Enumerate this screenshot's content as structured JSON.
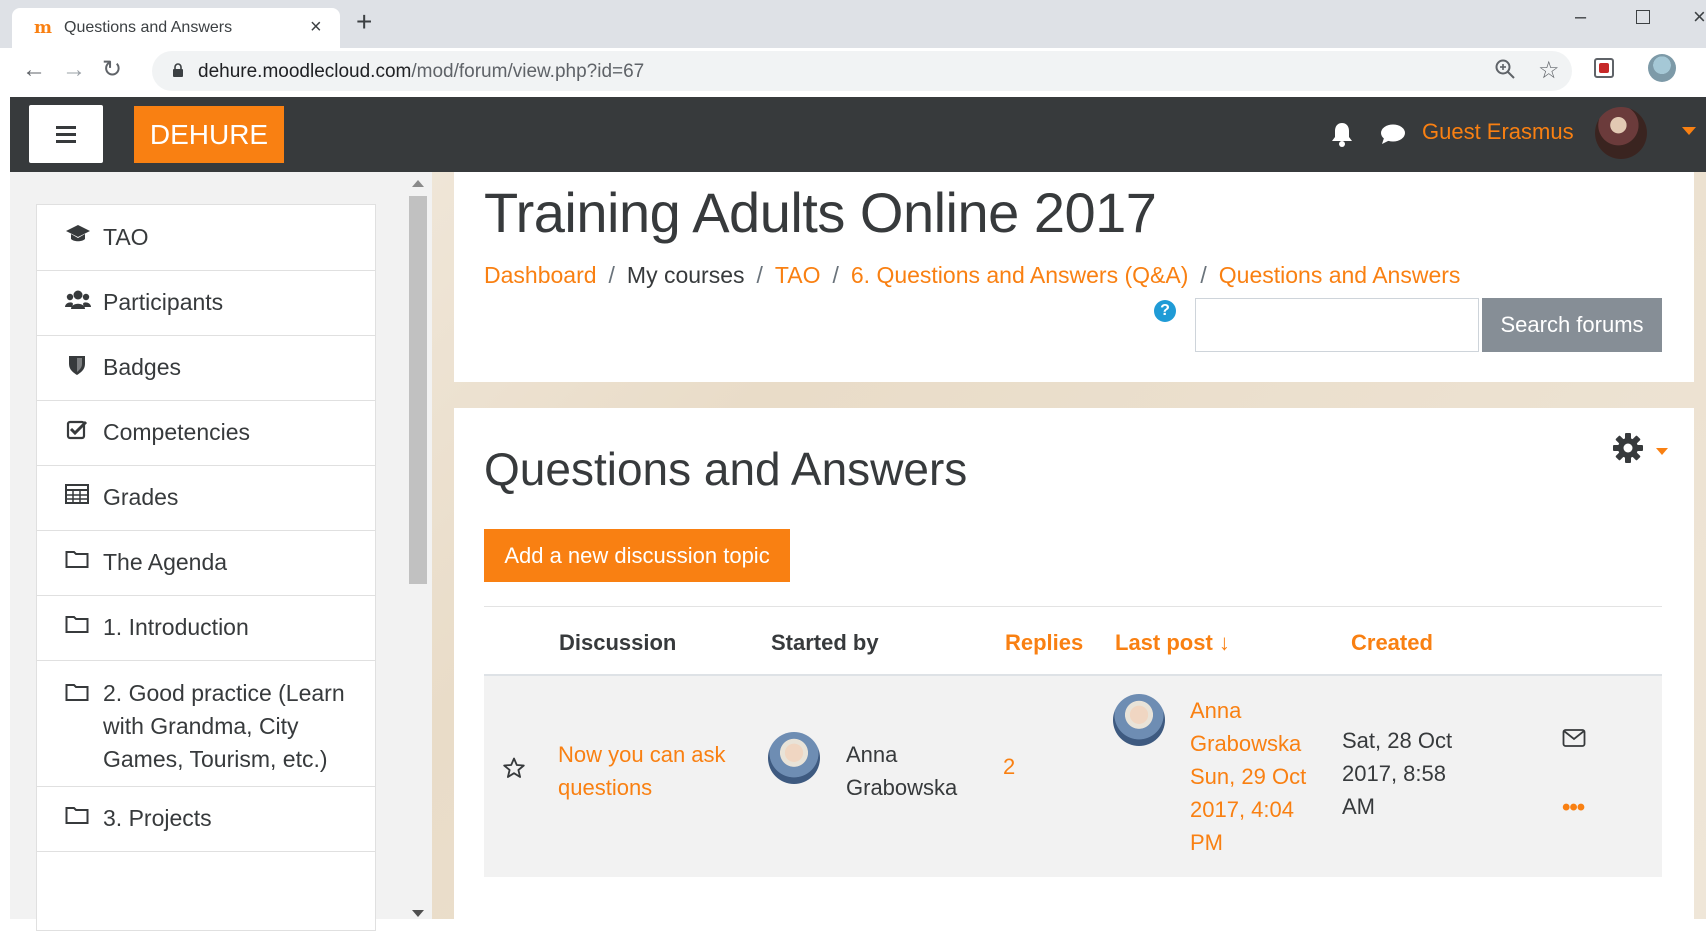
{
  "browser": {
    "tab_title": "Questions and Answers",
    "tab_favicon": "m",
    "tab_close": "×",
    "new_tab": "+",
    "window_minimize": "–",
    "window_close": "×",
    "url_host": "dehure.moodlecloud.com",
    "url_path": "/mod/forum/view.php?id=67",
    "back": "←",
    "forward": "→",
    "reload": "↻",
    "bookmark": "☆",
    "menu": "⋮"
  },
  "navbar": {
    "brand": "DEHURE",
    "user_name": "Guest Erasmus",
    "accent_color": "#f98012",
    "bar_color": "#373a3c"
  },
  "drawer": {
    "items": [
      {
        "icon": "graduation-cap-icon",
        "glyph": "🎓",
        "label": "TAO"
      },
      {
        "icon": "users-icon",
        "glyph": "👥",
        "label": "Participants"
      },
      {
        "icon": "shield-icon",
        "glyph": "⛊",
        "label": "Badges"
      },
      {
        "icon": "check-square-icon",
        "glyph": "☑",
        "label": "Competencies"
      },
      {
        "icon": "table-icon",
        "glyph": "▦",
        "label": "Grades"
      },
      {
        "icon": "folder-icon",
        "glyph": "🗀",
        "label": "The Agenda"
      },
      {
        "icon": "folder-icon",
        "glyph": "🗀",
        "label": "1. Introduction"
      },
      {
        "icon": "folder-icon",
        "glyph": "🗀",
        "label": "2. Good practice (Learn with Grandma, City Games, Tourism, etc.)"
      },
      {
        "icon": "folder-icon",
        "glyph": "🗀",
        "label": "3. Projects"
      }
    ]
  },
  "header": {
    "course_title": "Training Adults Online 2017",
    "breadcrumb": [
      "Dashboard",
      "My courses",
      "TAO",
      "6. Questions and Answers (Q&A)",
      "Questions and Answers"
    ],
    "separator": "/",
    "help": "?",
    "search_value": "",
    "search_button": "Search forums"
  },
  "forum": {
    "title": "Questions and Answers",
    "add_button": "Add a new discussion topic",
    "columns": {
      "discussion": "Discussion",
      "started_by": "Started by",
      "replies": "Replies",
      "last_post": "Last post",
      "sort_arrow": "↓",
      "created": "Created"
    },
    "rows": [
      {
        "title": "Now you can ask questions",
        "started_by": "Anna Grabowska",
        "replies": "2",
        "last_post_author": "Anna Grabowska",
        "last_post_date": "Sun, 29 Oct 2017, 4:04 PM",
        "created": "Sat, 28 Oct 2017, 8:58 AM",
        "more": "•••"
      }
    ]
  }
}
